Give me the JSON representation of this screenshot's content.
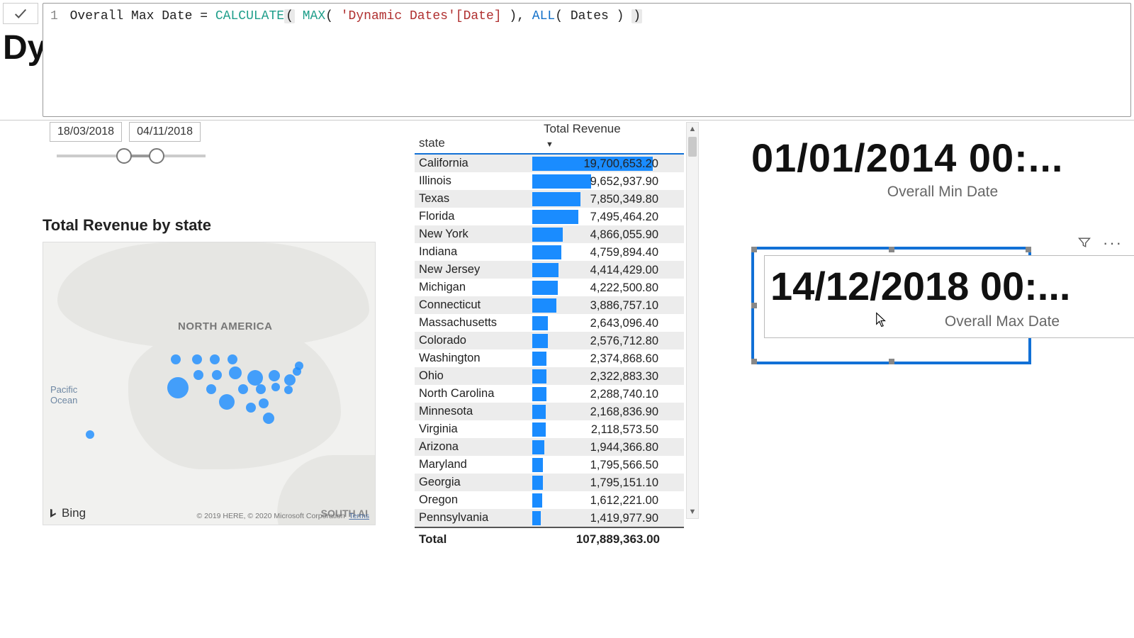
{
  "formula": {
    "line_number": "1",
    "measure_name": "Overall Max Date",
    "fn_calculate": "CALCULATE",
    "fn_max": "MAX",
    "ref_table_col": "'Dynamic Dates'[Date]",
    "fn_all": "ALL",
    "ref_all_table": "Dates"
  },
  "page_title_fragment": "Dy",
  "slicer": {
    "start_date": "18/03/2018",
    "end_date": "04/11/2018"
  },
  "map": {
    "title": "Total Revenue by state",
    "label_na": "NORTH AMERICA",
    "label_sa": "SOUTH AI",
    "water_label_1": "Pacific",
    "water_label_2": "Ocean",
    "bing": "Bing",
    "attribution": "© 2019 HERE, © 2020 Microsoft Corporation",
    "terms": "Terms"
  },
  "table": {
    "col_state": "state",
    "col_revenue": "Total Revenue",
    "total_label": "Total",
    "total_value": "107,889,363.00"
  },
  "cards": {
    "min_value": "01/01/2014 00:...",
    "min_label": "Overall Min Date",
    "max_value": "14/12/2018",
    "max_value_suffix": "00:...",
    "max_label": "Overall Max Date"
  },
  "chart_data": {
    "type": "table",
    "title": "Total Revenue by state",
    "columns": [
      "state",
      "Total Revenue"
    ],
    "rows": [
      {
        "state": "California",
        "value": 19700653.2,
        "value_fmt": "19,700,653.20",
        "bar_pct": 100
      },
      {
        "state": "Illinois",
        "value": 9652937.9,
        "value_fmt": "9,652,937.90",
        "bar_pct": 49
      },
      {
        "state": "Texas",
        "value": 7850349.8,
        "value_fmt": "7,850,349.80",
        "bar_pct": 40
      },
      {
        "state": "Florida",
        "value": 7495464.2,
        "value_fmt": "7,495,464.20",
        "bar_pct": 38
      },
      {
        "state": "New York",
        "value": 4866055.9,
        "value_fmt": "4,866,055.90",
        "bar_pct": 25
      },
      {
        "state": "Indiana",
        "value": 4759894.4,
        "value_fmt": "4,759,894.40",
        "bar_pct": 24
      },
      {
        "state": "New Jersey",
        "value": 4414429.0,
        "value_fmt": "4,414,429.00",
        "bar_pct": 22
      },
      {
        "state": "Michigan",
        "value": 4222500.8,
        "value_fmt": "4,222,500.80",
        "bar_pct": 21
      },
      {
        "state": "Connecticut",
        "value": 3886757.1,
        "value_fmt": "3,886,757.10",
        "bar_pct": 20
      },
      {
        "state": "Massachusetts",
        "value": 2643096.4,
        "value_fmt": "2,643,096.40",
        "bar_pct": 13
      },
      {
        "state": "Colorado",
        "value": 2576712.8,
        "value_fmt": "2,576,712.80",
        "bar_pct": 13
      },
      {
        "state": "Washington",
        "value": 2374868.6,
        "value_fmt": "2,374,868.60",
        "bar_pct": 12
      },
      {
        "state": "Ohio",
        "value": 2322883.3,
        "value_fmt": "2,322,883.30",
        "bar_pct": 12
      },
      {
        "state": "North Carolina",
        "value": 2288740.1,
        "value_fmt": "2,288,740.10",
        "bar_pct": 12
      },
      {
        "state": "Minnesota",
        "value": 2168836.9,
        "value_fmt": "2,168,836.90",
        "bar_pct": 11
      },
      {
        "state": "Virginia",
        "value": 2118573.5,
        "value_fmt": "2,118,573.50",
        "bar_pct": 11
      },
      {
        "state": "Arizona",
        "value": 1944366.8,
        "value_fmt": "1,944,366.80",
        "bar_pct": 10
      },
      {
        "state": "Maryland",
        "value": 1795566.5,
        "value_fmt": "1,795,566.50",
        "bar_pct": 9
      },
      {
        "state": "Georgia",
        "value": 1795151.1,
        "value_fmt": "1,795,151.10",
        "bar_pct": 9
      },
      {
        "state": "Oregon",
        "value": 1612221.0,
        "value_fmt": "1,612,221.00",
        "bar_pct": 8
      },
      {
        "state": "Pennsylvania",
        "value": 1419977.9,
        "value_fmt": "1,419,977.90",
        "bar_pct": 7
      }
    ],
    "total": 107889363.0
  }
}
